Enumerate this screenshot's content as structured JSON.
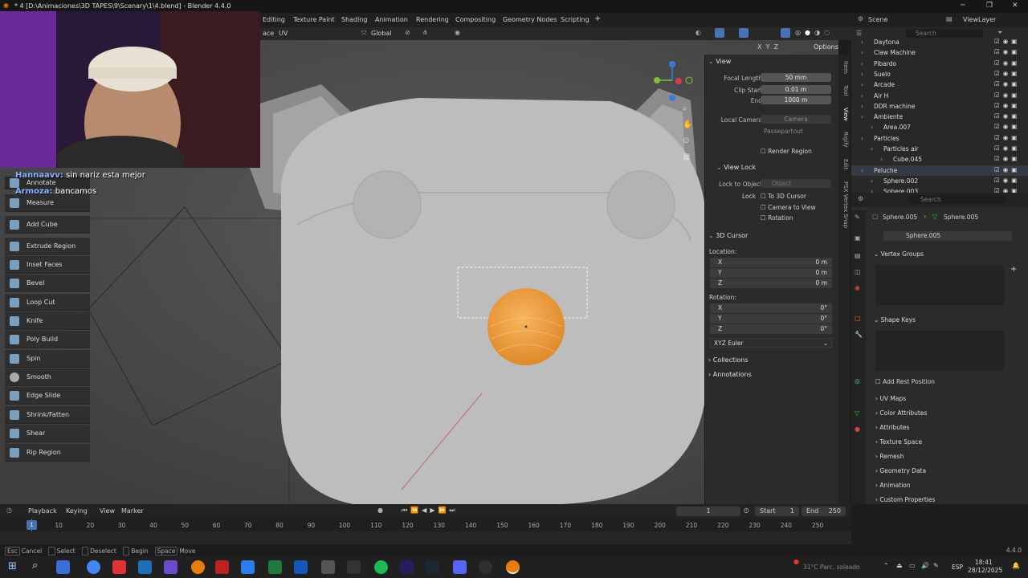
{
  "window": {
    "title": "* 4 [D:\\Animaciones\\3D TAPES\\9\\Scenary\\1\\4.blend] - Blender 4.4.0"
  },
  "workspaces": [
    "Editing",
    "Texture Paint",
    "Shading",
    "Animation",
    "Rendering",
    "Compositing",
    "Geometry Nodes",
    "Scripting"
  ],
  "topright": {
    "scene": "Scene",
    "viewlayer": "ViewLayer"
  },
  "viewport_header": {
    "mode_tail": "ace",
    "uv": "UV",
    "orientation": "Global",
    "options": "Options",
    "axes": [
      "X",
      "Y",
      "Z"
    ]
  },
  "chat": [
    {
      "user": "Hannaavv:",
      "text": "sin nariz esta mejor"
    },
    {
      "user": "Armoza:",
      "text": "bancamos"
    }
  ],
  "toolbar": {
    "annotate": "Annotate",
    "items": [
      "Measure",
      "Add Cube",
      "Extrude Region",
      "Inset Faces",
      "Bevel",
      "Loop Cut",
      "Knife",
      "Poly Build",
      "Spin",
      "Smooth",
      "Edge Slide",
      "Shrink/Fatten",
      "Shear",
      "Rip Region"
    ]
  },
  "npanel": {
    "view_title": "View",
    "focal_length": {
      "label": "Focal Length",
      "value": "50 mm"
    },
    "clip_start": {
      "label": "Clip Start",
      "value": "0.01 m"
    },
    "clip_end": {
      "label": "End",
      "value": "1000 m"
    },
    "local_camera": {
      "label": "Local Camera",
      "value": "Camera"
    },
    "passepartout": "Passepartout",
    "render_region": "Render Region",
    "view_lock_title": "View Lock",
    "lock_to_object": {
      "label": "Lock to Object",
      "placeholder": "Object"
    },
    "lock": {
      "label": "Lock",
      "to_cursor": "To 3D Cursor",
      "camera_to_view": "Camera to View",
      "rotation": "Rotation"
    },
    "cursor_title": "3D Cursor",
    "location_label": "Location:",
    "location": [
      {
        "axis": "X",
        "value": "0 m"
      },
      {
        "axis": "Y",
        "value": "0 m"
      },
      {
        "axis": "Z",
        "value": "0 m"
      }
    ],
    "rotation_label": "Rotation:",
    "rotation": [
      {
        "axis": "X",
        "value": "0°"
      },
      {
        "axis": "Y",
        "value": "0°"
      },
      {
        "axis": "Z",
        "value": "0°"
      }
    ],
    "euler": "XYZ Euler",
    "collections": "Collections",
    "annotations": "Annotations",
    "side_tabs": [
      "Item",
      "Tool",
      "View",
      "Rigify",
      "Edit",
      "PSX Vertex Snap"
    ]
  },
  "outliner": {
    "search_placeholder": "Search",
    "rows": [
      "Daytona",
      "Claw Machine",
      "Pibardo",
      "Suelo",
      "Arcade",
      "Air H",
      "DDR machine",
      "Ambiente",
      "Area.007",
      "Particles",
      "Particles air",
      "Cube.045",
      "Peluche",
      "Sphere.002",
      "Sphere.003"
    ]
  },
  "properties": {
    "search_placeholder": "Search",
    "breadcrumb": [
      "Sphere.005",
      "Sphere.005"
    ],
    "mesh_name": "Sphere.005",
    "vertex_groups": "Vertex Groups",
    "shape_keys": "Shape Keys",
    "add_rest_position": "Add Rest Position",
    "sections": [
      "UV Maps",
      "Color Attributes",
      "Attributes",
      "Texture Space",
      "Remesh",
      "Geometry Data",
      "Animation",
      "Custom Properties"
    ]
  },
  "timeline": {
    "menus": [
      "Playback",
      "Keying",
      "View",
      "Marker"
    ],
    "current_frame": "1",
    "start_label": "Start",
    "start": "1",
    "end_label": "End",
    "end": "250",
    "ticks": [
      "1",
      "10",
      "20",
      "30",
      "40",
      "50",
      "60",
      "70",
      "80",
      "90",
      "100",
      "110",
      "120",
      "130",
      "140",
      "150",
      "160",
      "170",
      "180",
      "190",
      "200",
      "210",
      "220",
      "230",
      "240",
      "250"
    ]
  },
  "statusbar": {
    "keys": [
      {
        "key": "Esc",
        "label": "Cancel"
      },
      {
        "key": "",
        "label": "Select"
      },
      {
        "key": "",
        "label": "Deselect"
      },
      {
        "key": "",
        "label": "Begin"
      },
      {
        "key": "Space",
        "label": "Move"
      }
    ],
    "version": "4.4.0"
  },
  "taskbar": {
    "weather": "31°C  Parc. soleado",
    "lang": "ESP",
    "time": "18:41",
    "date": "28/12/2025"
  },
  "colors": {
    "accent": "#4772b3",
    "selection_orange": "#f0a040",
    "viewport_bg": "#4a4a4a"
  }
}
